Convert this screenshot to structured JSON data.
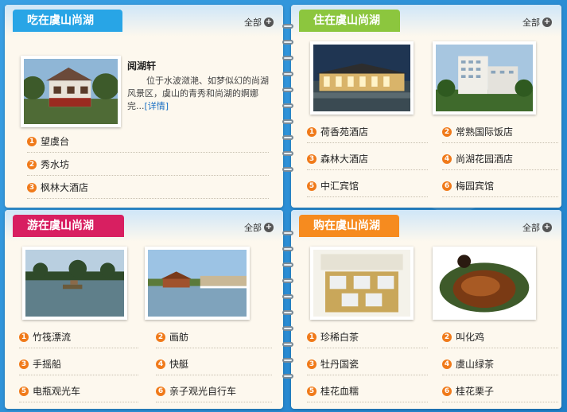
{
  "panels": {
    "eat": {
      "tab": "吃在虞山尚湖",
      "more": "全部",
      "feature": {
        "title": "阅湖轩",
        "desc": "位于水波潋滟、如梦似幻的尚湖风景区，虞山的青秀和尚湖的婀娜完",
        "ellipsis": "...",
        "link": "[详情]"
      },
      "items": [
        {
          "num": "1",
          "label": "望虞台"
        },
        {
          "num": "2",
          "label": "秀水坊"
        },
        {
          "num": "3",
          "label": "枫林大酒店"
        }
      ]
    },
    "stay": {
      "tab": "住在虞山尚湖",
      "more": "全部",
      "items": [
        {
          "num": "1",
          "label": "荷香苑酒店"
        },
        {
          "num": "2",
          "label": "常熟国际饭店"
        },
        {
          "num": "3",
          "label": "森林大酒店"
        },
        {
          "num": "4",
          "label": "尚湖花园酒店"
        },
        {
          "num": "5",
          "label": "中汇宾馆"
        },
        {
          "num": "6",
          "label": "梅园宾馆"
        }
      ]
    },
    "tour": {
      "tab": "游在虞山尚湖",
      "more": "全部",
      "items": [
        {
          "num": "1",
          "label": "竹筏漂流"
        },
        {
          "num": "2",
          "label": "画舫"
        },
        {
          "num": "3",
          "label": "手摇船"
        },
        {
          "num": "4",
          "label": "快艇"
        },
        {
          "num": "5",
          "label": "电瓶观光车"
        },
        {
          "num": "6",
          "label": "亲子观光自行车"
        }
      ]
    },
    "shop": {
      "tab": "购在虞山尚湖",
      "more": "全部",
      "items": [
        {
          "num": "1",
          "label": "珍稀白茶"
        },
        {
          "num": "2",
          "label": "叫化鸡"
        },
        {
          "num": "3",
          "label": "牡丹国瓷"
        },
        {
          "num": "4",
          "label": "虞山绿茶"
        },
        {
          "num": "5",
          "label": "桂花血糯"
        },
        {
          "num": "6",
          "label": "桂花栗子"
        }
      ]
    }
  },
  "colors": {
    "eat_tab": "#28a5e6",
    "stay_tab": "#8cc63e",
    "tour_tab": "#d81f61",
    "shop_tab": "#f68b1f",
    "number_badge": "#f07a1a"
  }
}
